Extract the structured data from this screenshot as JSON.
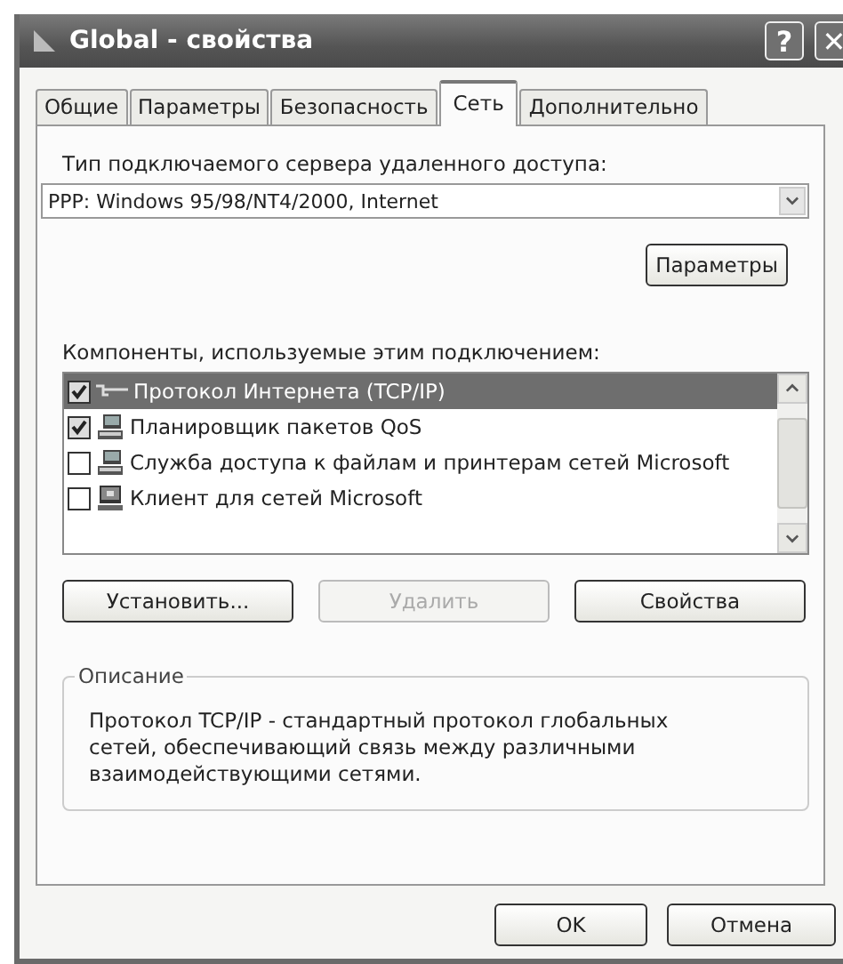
{
  "window": {
    "title": "Global - свойства",
    "help": "?",
    "close": "✕"
  },
  "tabs": [
    {
      "label": "Общие",
      "selected": false
    },
    {
      "label": "Параметры",
      "selected": false
    },
    {
      "label": "Безопасность",
      "selected": false
    },
    {
      "label": "Сеть",
      "selected": true
    },
    {
      "label": "Дополнительно",
      "selected": false
    }
  ],
  "server_type": {
    "label": "Тип подключаемого сервера удаленного доступа:",
    "value": "PPP: Windows 95/98/NT4/2000, Internet",
    "settings_button": "Параметры"
  },
  "components": {
    "label": "Компоненты, используемые этим подключением:",
    "items": [
      {
        "kind": "protocol",
        "label": "Протокол Интернета (TCP/IP)",
        "checked": true,
        "selected": true
      },
      {
        "kind": "service",
        "label": "Планировщик пакетов QoS",
        "checked": true,
        "selected": false
      },
      {
        "kind": "service",
        "label": "Служба доступа к файлам и принтерам сетей Microsoft",
        "checked": false,
        "selected": false
      },
      {
        "kind": "client",
        "label": "Клиент для сетей Microsoft",
        "checked": false,
        "selected": false
      }
    ]
  },
  "component_buttons": [
    {
      "label": "Установить...",
      "disabled": false
    },
    {
      "label": "Удалить",
      "disabled": true
    },
    {
      "label": "Свойства",
      "disabled": false
    }
  ],
  "description": {
    "title": "Описание",
    "text": "Протокол TCP/IP - стандартный протокол глобальных сетей, обеспечивающий связь между различными взаимодействующими сетями."
  },
  "buttons": [
    "OK",
    "Отмена"
  ]
}
